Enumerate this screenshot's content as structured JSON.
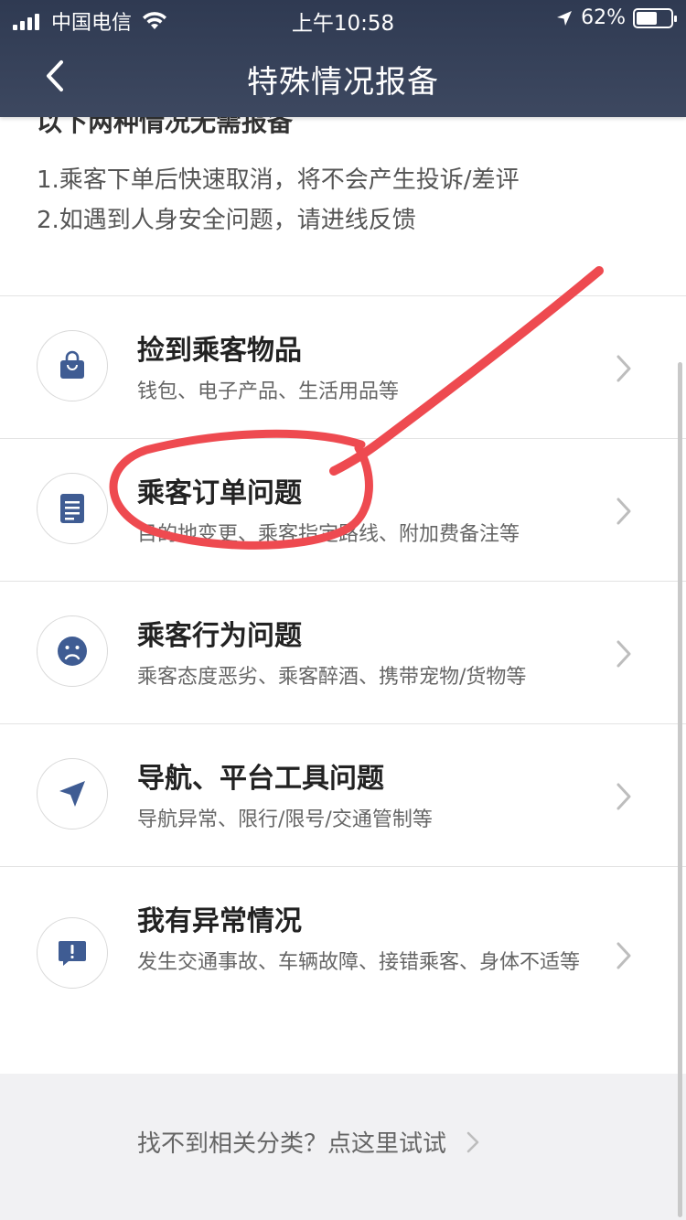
{
  "status_bar": {
    "carrier": "中国电信",
    "time": "上午10:58",
    "battery": "62%",
    "battery_level": 0.62
  },
  "nav": {
    "title": "特殊情况报备",
    "back_icon": "chevron-left-icon"
  },
  "notice": {
    "title": "以下两种情况无需报备",
    "lines": [
      "1.乘客下单后快速取消，将不会产生投诉/差评",
      "2.如遇到人身安全问题，请进线反馈"
    ]
  },
  "items": [
    {
      "title": "捡到乘客物品",
      "subtitle": "钱包、电子产品、生活用品等",
      "icon": "shopping-bag-icon"
    },
    {
      "title": "乘客订单问题",
      "subtitle": "目的地变更、乘客指定路线、附加费备注等",
      "icon": "document-icon"
    },
    {
      "title": "乘客行为问题",
      "subtitle": "乘客态度恶劣、乘客醉酒、携带宠物/货物等",
      "icon": "sad-face-icon"
    },
    {
      "title": "导航、平台工具问题",
      "subtitle": "导航异常、限行/限号/交通管制等",
      "icon": "navigation-arrow-icon"
    },
    {
      "title": "我有异常情况",
      "subtitle": "发生交通事故、车辆故障、接错乘客、身体不适等",
      "icon": "alert-message-icon"
    }
  ],
  "footer": {
    "link": "找不到相关分类？点这里试试"
  },
  "colors": {
    "header_bg": "#3d4860",
    "icon_blue": "#3f5c93",
    "annotation_red": "#ee4a50",
    "footer_bg": "#f1f1f3"
  }
}
